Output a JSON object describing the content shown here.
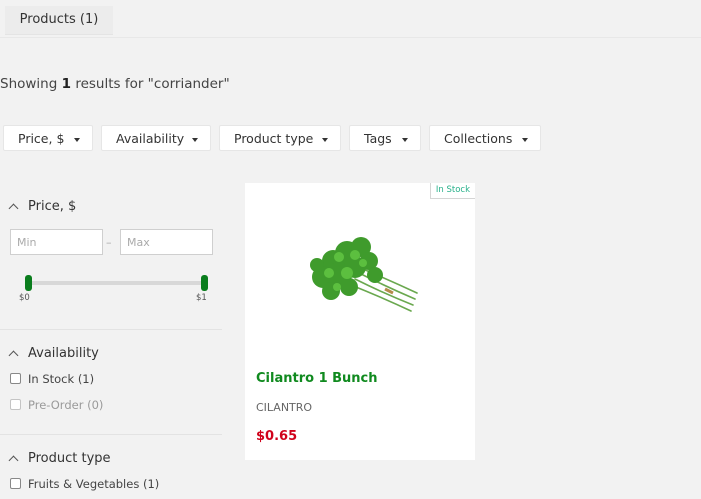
{
  "tab": {
    "label": "Products (1)"
  },
  "results": {
    "prefix": "Showing",
    "count": "1",
    "suffix": "results for \"corriander\""
  },
  "filters": [
    "Price, $",
    "Availability",
    "Product type",
    "Tags",
    "Collections"
  ],
  "sidebar": {
    "price": {
      "title": "Price, $",
      "min_placeholder": "Min",
      "max_placeholder": "Max",
      "separator": "–",
      "range_min_label": "$0",
      "range_max_label": "$1"
    },
    "availability": {
      "title": "Availability",
      "options": [
        {
          "label": "In Stock (1)",
          "disabled": false
        },
        {
          "label": "Pre-Order (0)",
          "disabled": true
        }
      ]
    },
    "product_type": {
      "title": "Product type",
      "options": [
        {
          "label": "Fruits & Vegetables (1)"
        }
      ]
    }
  },
  "product": {
    "badge": "In Stock",
    "title": "Cilantro 1 Bunch",
    "vendor": "CILANTRO",
    "price": "$0.65",
    "image_icon": "cilantro-image"
  },
  "colors": {
    "accent_green": "#108a1f",
    "price_red": "#d0021b",
    "badge_teal": "#27b08a",
    "slider_handle": "#0a7d1d"
  }
}
